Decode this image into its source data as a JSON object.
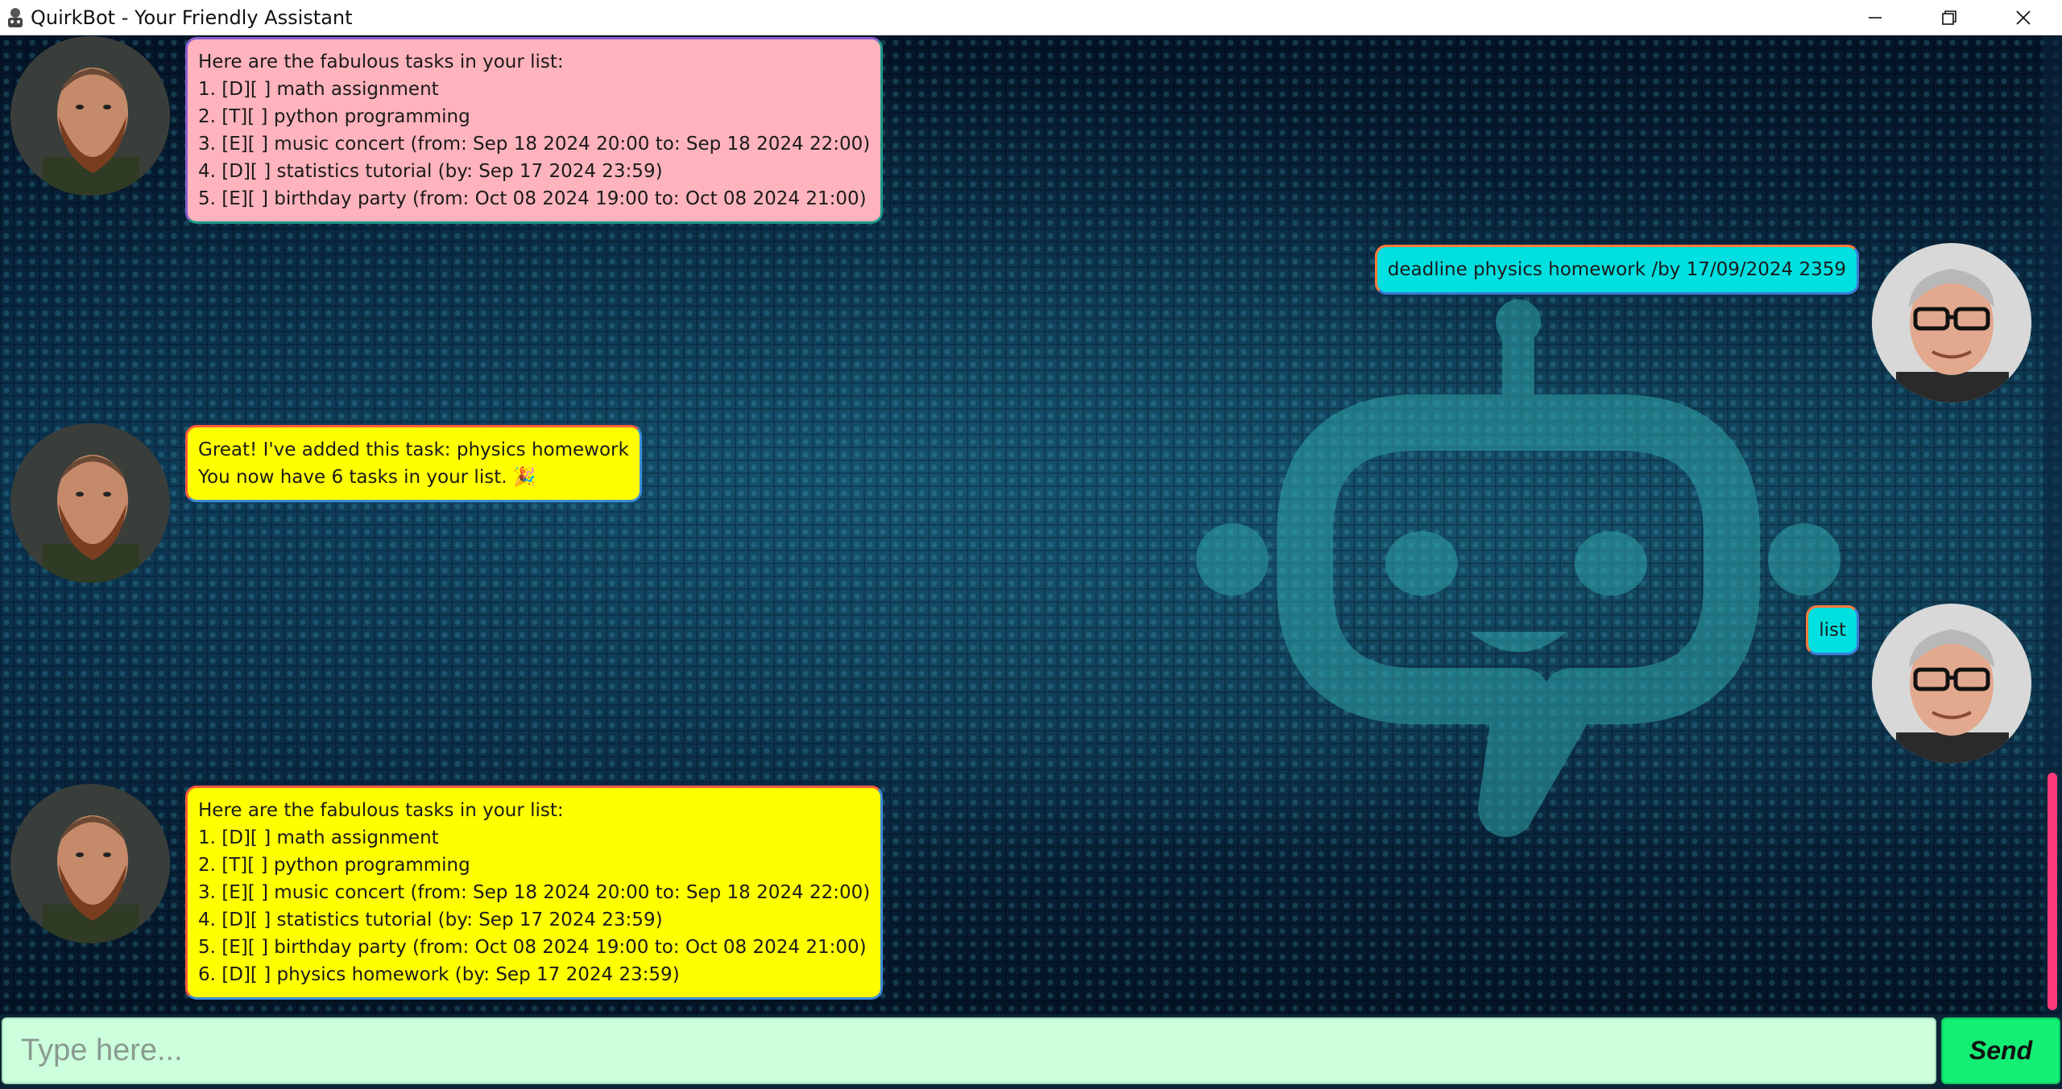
{
  "window": {
    "title": "QuirkBot - Your Friendly Assistant",
    "controls": [
      "minimize",
      "maximize",
      "close"
    ]
  },
  "messages": [
    {
      "sender": "bot",
      "color": "#ffb3bd",
      "lines": [
        "Here are the fabulous tasks in your list:",
        "1. [D][ ] math assignment",
        "2. [T][ ] python programming",
        "3. [E][ ] music concert (from: Sep 18 2024 20:00 to: Sep 18 2024 22:00)",
        "4. [D][ ] statistics tutorial (by: Sep 17 2024 23:59)",
        "5. [E][ ] birthday party (from: Oct 08 2024 19:00 to: Oct 08 2024 21:00)"
      ]
    },
    {
      "sender": "user",
      "color": "#00e0e0",
      "lines": [
        "deadline physics homework /by 17/09/2024 2359"
      ]
    },
    {
      "sender": "bot",
      "color": "#ffff00",
      "lines": [
        "Great! I've added this task: physics homework",
        "You now have 6 tasks in your list. 🎉"
      ]
    },
    {
      "sender": "user",
      "color": "#00e0e0",
      "lines": [
        "list"
      ]
    },
    {
      "sender": "bot",
      "color": "#ffff00",
      "lines": [
        "Here are the fabulous tasks in your list:",
        "1. [D][ ] math assignment",
        "2. [T][ ] python programming",
        "3. [E][ ] music concert (from: Sep 18 2024 20:00 to: Sep 18 2024 22:00)",
        "4. [D][ ] statistics tutorial (by: Sep 17 2024 23:59)",
        "5. [E][ ] birthday party (from: Oct 08 2024 19:00 to: Oct 08 2024 21:00)",
        "6. [D][ ] physics homework (by: Sep 17 2024 23:59)"
      ]
    }
  ],
  "input": {
    "placeholder": "Type here...",
    "value": ""
  },
  "send_button": {
    "label": "Send"
  },
  "colors": {
    "input_bg": "#ccffdc",
    "send_bg": "#14ee74",
    "scroll_thumb": "#ff3a7a",
    "background": "#061a2c"
  }
}
